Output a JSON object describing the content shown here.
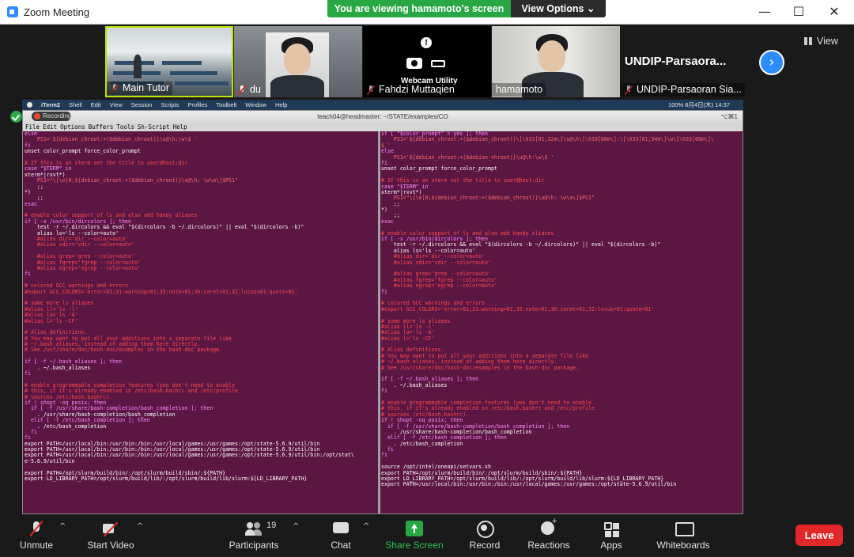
{
  "window": {
    "title": "Zoom Meeting",
    "controls": [
      "—",
      "☐",
      "✕"
    ]
  },
  "banner": {
    "sharing_text": "You are viewing hamamoto's screen",
    "view_options": "View Options ⌄"
  },
  "gallery": {
    "participants": [
      {
        "name": "Main Tutor"
      },
      {
        "name": "du"
      },
      {
        "name": "Fahdzi Muttaqien",
        "overlay": "Webcam Utility"
      },
      {
        "name": "hamamoto"
      },
      {
        "name": "UNDIP-Parsaoran Sia...",
        "headline": "UNDIP-Parsaora..."
      }
    ],
    "view_label": "View",
    "next": "›"
  },
  "mac_menubar": {
    "items": [
      "iTerm2",
      "Shell",
      "Edit",
      "View",
      "Session",
      "Scripts",
      "Profiles",
      "Toolbelt",
      "Window",
      "Help"
    ],
    "status": "100%  8月4日(木)  14:37"
  },
  "recording_label": "Recording",
  "terminal": {
    "title": "teach04@headmaster: ~/STATE/examples/CO",
    "tab_hint": "⌥⌘1",
    "emacs_menu": [
      "File",
      "Edit",
      "Options",
      "Buffers",
      "Tools",
      "Sh-Script",
      "Help"
    ],
    "left_pane": [
      {
        "t": "else",
        "c": "c-keyword"
      },
      {
        "t": "    PS1='${debian_chroot:+($debian_chroot)}\\u@\\h:\\w\\$ '",
        "c": "c-string"
      },
      {
        "t": "fi",
        "c": "c-keyword"
      },
      {
        "t": "unset color_prompt force_color_prompt",
        "c": "c-normal"
      },
      {
        "t": "",
        "c": "c-normal"
      },
      {
        "t": "# If this is an xterm set the title to user@host:dir",
        "c": "c-comment"
      },
      {
        "t": "case \"$TERM\" in",
        "c": "c-keyword"
      },
      {
        "t": "xterm*|rxvt*)",
        "c": "c-normal"
      },
      {
        "t": "    PS1=\"\\[\\e]0;${debian_chroot:+($debian_chroot)}\\u@\\h: \\w\\a\\]$PS1\"",
        "c": "c-string"
      },
      {
        "t": "    ;;",
        "c": "c-normal"
      },
      {
        "t": "*)",
        "c": "c-normal"
      },
      {
        "t": "    ;;",
        "c": "c-normal"
      },
      {
        "t": "esac",
        "c": "c-keyword"
      },
      {
        "t": "",
        "c": "c-normal"
      },
      {
        "t": "# enable color support of ls and also add handy aliases",
        "c": "c-comment"
      },
      {
        "t": "if [ -x /usr/bin/dircolors ]; then",
        "c": "c-keyword"
      },
      {
        "t": "    test -r ~/.dircolors && eval \"$(dircolors -b ~/.dircolors)\" || eval \"$(dircolors -b)\"",
        "c": "c-normal"
      },
      {
        "t": "    alias ls='ls --color=auto'",
        "c": "c-normal"
      },
      {
        "t": "    #alias dir='dir --color=auto'",
        "c": "c-comment"
      },
      {
        "t": "    #alias vdir='vdir --color=auto'",
        "c": "c-comment"
      },
      {
        "t": "",
        "c": "c-normal"
      },
      {
        "t": "    #alias grep='grep --color=auto'",
        "c": "c-comment"
      },
      {
        "t": "    #alias fgrep='fgrep --color=auto'",
        "c": "c-comment"
      },
      {
        "t": "    #alias egrep='egrep --color=auto'",
        "c": "c-comment"
      },
      {
        "t": "fi",
        "c": "c-keyword"
      },
      {
        "t": "",
        "c": "c-normal"
      },
      {
        "t": "# colored GCC warnings and errors",
        "c": "c-comment"
      },
      {
        "t": "#export GCC_COLORS='error=01;31:warning=01;35:note=01;36:caret=01;32:locus=01:quote=01'",
        "c": "c-comment"
      },
      {
        "t": "",
        "c": "c-normal"
      },
      {
        "t": "# some more ls aliases",
        "c": "c-comment"
      },
      {
        "t": "#alias ll='ls -l'",
        "c": "c-comment"
      },
      {
        "t": "#alias la='ls -A'",
        "c": "c-comment"
      },
      {
        "t": "#alias l='ls -CF'",
        "c": "c-comment"
      },
      {
        "t": "",
        "c": "c-normal"
      },
      {
        "t": "# Alias definitions.",
        "c": "c-comment"
      },
      {
        "t": "# You may want to put all your additions into a separate file like",
        "c": "c-comment"
      },
      {
        "t": "# ~/.bash_aliases, instead of adding them here directly.",
        "c": "c-comment"
      },
      {
        "t": "# See /usr/share/doc/bash-doc/examples in the bash-doc package.",
        "c": "c-comment"
      },
      {
        "t": "",
        "c": "c-normal"
      },
      {
        "t": "if [ -f ~/.bash_aliases ]; then",
        "c": "c-keyword"
      },
      {
        "t": "    . ~/.bash_aliases",
        "c": "c-normal"
      },
      {
        "t": "fi",
        "c": "c-keyword"
      },
      {
        "t": "",
        "c": "c-normal"
      },
      {
        "t": "# enable programmable completion features (you don't need to enable",
        "c": "c-comment"
      },
      {
        "t": "# this, if it's already enabled in /etc/bash.bashrc and /etc/profile",
        "c": "c-comment"
      },
      {
        "t": "# sources /etc/bash.bashrc).",
        "c": "c-comment"
      },
      {
        "t": "if ! shopt -oq posix; then",
        "c": "c-keyword"
      },
      {
        "t": "  if [ -f /usr/share/bash-completion/bash_completion ]; then",
        "c": "c-keyword"
      },
      {
        "t": "    . /usr/share/bash-completion/bash_completion",
        "c": "c-normal"
      },
      {
        "t": "  elif [ -f /etc/bash_completion ]; then",
        "c": "c-keyword"
      },
      {
        "t": "    . /etc/bash_completion",
        "c": "c-normal"
      },
      {
        "t": "  fi",
        "c": "c-keyword"
      },
      {
        "t": "fi",
        "c": "c-keyword"
      },
      {
        "t": "export PATH=/usr/local/bin:/usr/bin:/bin:/usr/local/games:/usr/games:/opt/state-5.6.9/util/bin",
        "c": "c-normal"
      },
      {
        "t": "export PATH=/usr/local/bin:/usr/bin:/bin:/usr/local/games:/usr/games:/opt/state-5.6.9/util/bin",
        "c": "c-normal"
      },
      {
        "t": "export PATH=/usr/local/bin:/usr/bin:/bin:/usr/local/games:/usr/games:/opt/state-5.6.9/util/bin:/opt/stat\\",
        "c": "c-normal"
      },
      {
        "t": "e-5.6.9/util/bin",
        "c": "c-normal"
      },
      {
        "t": "",
        "c": "c-normal"
      },
      {
        "t": "export PATH=/opt/slurm/build/bin/:/opt/slurm/build/sbin/:${PATH}",
        "c": "c-normal"
      },
      {
        "t": "export LD_LIBRARY_PATH=/opt/slurm/build/lib/:/opt/slurm/build/lib/slurm:${LD_LIBRARY_PATH}",
        "c": "c-normal"
      }
    ],
    "right_pane": [
      {
        "t": "if [ \"$color_prompt\" = yes ]; then",
        "c": "c-keyword"
      },
      {
        "t": "    PS1='${debian_chroot:+($debian_chroot)}\\[\\033[01;32m\\]\\u@\\h\\[\\033[00m\\]:\\[\\033[01;34m\\]\\w\\[\\033[00m\\]\\",
        "c": "c-string"
      },
      {
        "t": "$ '",
        "c": "c-string"
      },
      {
        "t": "else",
        "c": "c-keyword"
      },
      {
        "t": "    PS1='${debian_chroot:+($debian_chroot)}\\u@\\h:\\w\\$ '",
        "c": "c-string"
      },
      {
        "t": "fi",
        "c": "c-keyword"
      },
      {
        "t": "unset color_prompt force_color_prompt",
        "c": "c-normal"
      },
      {
        "t": "",
        "c": "c-normal"
      },
      {
        "t": "# If this is an xterm set the title to user@host:dir",
        "c": "c-comment"
      },
      {
        "t": "case \"$TERM\" in",
        "c": "c-keyword"
      },
      {
        "t": "xterm*|rxvt*)",
        "c": "c-normal"
      },
      {
        "t": "    PS1=\"\\[\\e]0;${debian_chroot:+($debian_chroot)}\\u@\\h: \\w\\a\\]$PS1\"",
        "c": "c-string"
      },
      {
        "t": "    ;;",
        "c": "c-normal"
      },
      {
        "t": "*)",
        "c": "c-normal"
      },
      {
        "t": "    ;;",
        "c": "c-normal"
      },
      {
        "t": "esac",
        "c": "c-keyword"
      },
      {
        "t": "",
        "c": "c-normal"
      },
      {
        "t": "# enable color support of ls and also add handy aliases",
        "c": "c-comment"
      },
      {
        "t": "if [ -x /usr/bin/dircolors ]; then",
        "c": "c-keyword"
      },
      {
        "t": "    test -r ~/.dircolors && eval \"$(dircolors -b ~/.dircolors)\" || eval \"$(dircolors -b)\"",
        "c": "c-normal"
      },
      {
        "t": "    alias ls='ls --color=auto'",
        "c": "c-normal"
      },
      {
        "t": "    #alias dir='dir --color=auto'",
        "c": "c-comment"
      },
      {
        "t": "    #alias vdir='vdir --color=auto'",
        "c": "c-comment"
      },
      {
        "t": "",
        "c": "c-normal"
      },
      {
        "t": "    #alias grep='grep --color=auto'",
        "c": "c-comment"
      },
      {
        "t": "    #alias fgrep='fgrep --color=auto'",
        "c": "c-comment"
      },
      {
        "t": "    #alias egrep='egrep --color=auto'",
        "c": "c-comment"
      },
      {
        "t": "fi",
        "c": "c-keyword"
      },
      {
        "t": "",
        "c": "c-normal"
      },
      {
        "t": "# colored GCC warnings and errors",
        "c": "c-comment"
      },
      {
        "t": "#export GCC_COLORS='error=01;31:warning=01;35:note=01;36:caret=01;32:locus=01:quote=01'",
        "c": "c-comment"
      },
      {
        "t": "",
        "c": "c-normal"
      },
      {
        "t": "# some more ls aliases",
        "c": "c-comment"
      },
      {
        "t": "#alias ll='ls -l'",
        "c": "c-comment"
      },
      {
        "t": "#alias la='ls -A'",
        "c": "c-comment"
      },
      {
        "t": "#alias l='ls -CF'",
        "c": "c-comment"
      },
      {
        "t": "",
        "c": "c-normal"
      },
      {
        "t": "# Alias definitions.",
        "c": "c-comment"
      },
      {
        "t": "# You may want to put all your additions into a separate file like",
        "c": "c-comment"
      },
      {
        "t": "# ~/.bash_aliases, instead of adding them here directly.",
        "c": "c-comment"
      },
      {
        "t": "# See /usr/share/doc/bash-doc/examples in the bash-doc package.",
        "c": "c-comment"
      },
      {
        "t": "",
        "c": "c-normal"
      },
      {
        "t": "if [ -f ~/.bash_aliases ]; then",
        "c": "c-keyword"
      },
      {
        "t": "    . ~/.bash_aliases",
        "c": "c-normal"
      },
      {
        "t": "fi",
        "c": "c-keyword"
      },
      {
        "t": "",
        "c": "c-normal"
      },
      {
        "t": "# enable programmable completion features (you don't need to enable",
        "c": "c-comment"
      },
      {
        "t": "# this, if it's already enabled in /etc/bash.bashrc and /etc/profile",
        "c": "c-comment"
      },
      {
        "t": "# sources /etc/bash.bashrc).",
        "c": "c-comment"
      },
      {
        "t": "if ! shopt -oq posix; then",
        "c": "c-keyword"
      },
      {
        "t": "  if [ -f /usr/share/bash-completion/bash_completion ]; then",
        "c": "c-keyword"
      },
      {
        "t": "    . /usr/share/bash-completion/bash_completion",
        "c": "c-normal"
      },
      {
        "t": "  elif [ -f /etc/bash_completion ]; then",
        "c": "c-keyword"
      },
      {
        "t": "    . /etc/bash_completion",
        "c": "c-normal"
      },
      {
        "t": "  fi",
        "c": "c-keyword"
      },
      {
        "t": "fi",
        "c": "c-keyword"
      },
      {
        "t": "",
        "c": "c-normal"
      },
      {
        "t": "source /opt/intel/oneapi/setvars.sh",
        "c": "c-normal"
      },
      {
        "t": "export PATH=/opt/slurm/build/bin/:/opt/slurm/build/sbin/:${PATH}",
        "c": "c-normal"
      },
      {
        "t": "export LD_LIBRARY_PATH=/opt/slurm/build/lib/:/opt/slurm/build/lib/slurm:${LD_LIBRARY_PATH}",
        "c": "c-normal"
      },
      {
        "t": "export PATH=/usr/local/bin:/usr/bin:/bin:/usr/local/games:/usr/games:/opt/state-5.6.9/util/bin",
        "c": "c-normal"
      }
    ]
  },
  "toolbar": {
    "unmute": "Unmute",
    "start_video": "Start Video",
    "participants": "Participants",
    "participants_count": "19",
    "chat": "Chat",
    "share_screen": "Share Screen",
    "record": "Record",
    "reactions": "Reactions",
    "apps": "Apps",
    "whiteboards": "Whiteboards",
    "leave": "Leave",
    "caret": "^"
  },
  "colors": {
    "share_green": "#27a844",
    "terminal_bg": "#5c1644",
    "leave_red": "#e02828",
    "zoom_blue": "#2d8cff"
  }
}
